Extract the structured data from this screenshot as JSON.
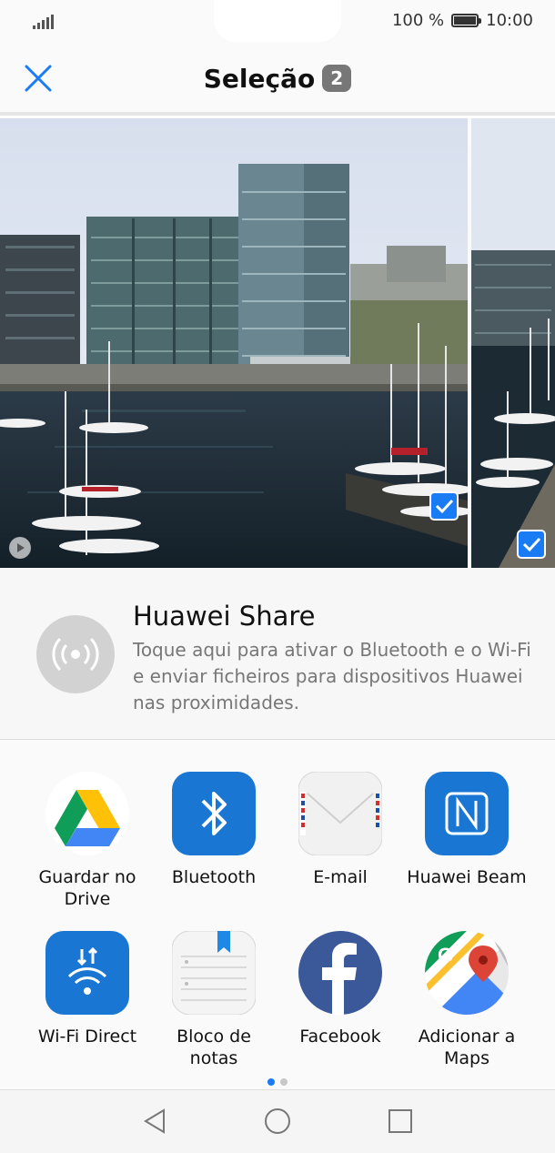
{
  "status": {
    "battery": "100 %",
    "time": "10:00"
  },
  "header": {
    "title": "Seleção",
    "count": "2"
  },
  "photos": [
    {
      "selected": true
    },
    {
      "selected": true
    }
  ],
  "share": {
    "title": "Huawei Share",
    "description": "Toque aqui para ativar o Bluetooth e o Wi-Fi e enviar ficheiros para dispositivos Huawei nas proximidades."
  },
  "apps": [
    {
      "label": "Guardar no Drive",
      "icon": "google-drive-icon"
    },
    {
      "label": "Bluetooth",
      "icon": "bluetooth-icon"
    },
    {
      "label": "E-mail",
      "icon": "email-icon"
    },
    {
      "label": "Huawei Beam",
      "icon": "nfc-icon"
    },
    {
      "label": "Wi-Fi Direct",
      "icon": "wifi-direct-icon"
    },
    {
      "label": "Bloco de notas",
      "icon": "notepad-icon"
    },
    {
      "label": "Facebook",
      "icon": "facebook-icon"
    },
    {
      "label": "Adicionar a Maps",
      "icon": "google-maps-icon"
    }
  ],
  "pager": {
    "pages": 2,
    "current": 1
  },
  "colors": {
    "accent": "#1a7cf5",
    "bluetooth": "#1976d2",
    "facebook": "#3b5998"
  }
}
